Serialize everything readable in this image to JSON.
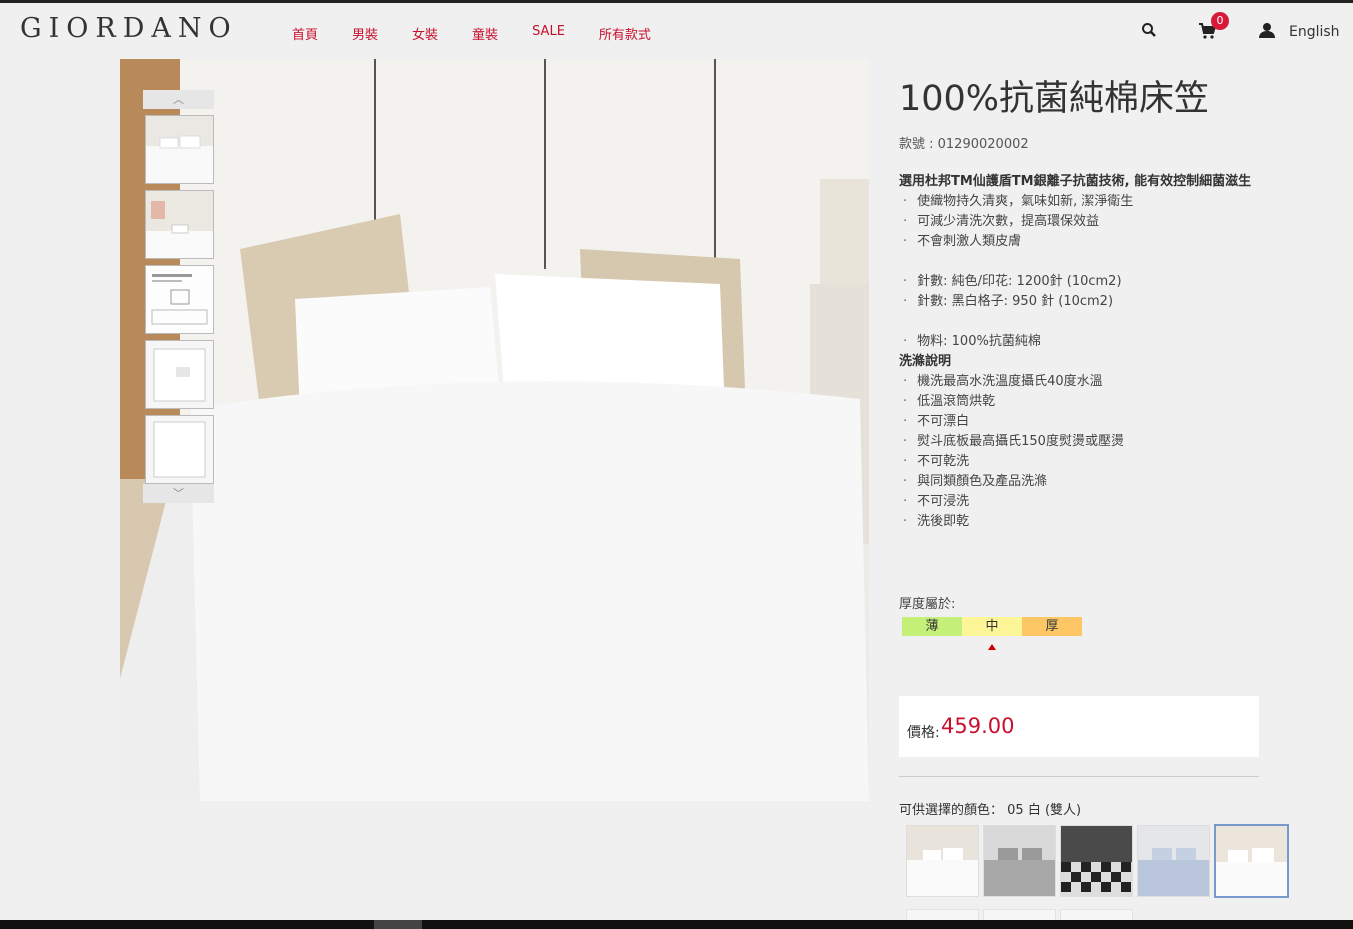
{
  "brand": "GIORDANO",
  "nav": [
    "首頁",
    "男裝",
    "女裝",
    "童裝",
    "SALE",
    "所有款式"
  ],
  "header": {
    "cart_count": "0",
    "language": "English"
  },
  "product": {
    "title": "100%抗菌純棉床笠",
    "sku": "款號 : 01290020002",
    "intro": "選用杜邦TM仙護盾TM銀離子抗菌技術, 能有效控制細菌滋生",
    "features": [
      "使織物持久清爽，氣味如新, 潔淨衛生",
      "可減少清洗次數，提高環保效益",
      "不會刺激人類皮膚"
    ],
    "thread_count": [
      "針數: 純色/印花: 1200針 (10cm2)",
      "針數: 黑白格子: 950 針 (10cm2)"
    ],
    "material": "物料: 100%抗菌純棉",
    "care_heading": "洗滌說明",
    "care": [
      "機洗最高水洗溫度攝氏40度水溫",
      "低溫滾筒烘乾",
      "不可漂白",
      "熨斗底板最高攝氏150度熨燙或壓燙",
      "不可乾洗",
      "與同類顏色及產品洗滌",
      "不可浸洗",
      "洗後即乾"
    ]
  },
  "thickness": {
    "label": "厚度屬於:",
    "levels": [
      "薄",
      "中",
      "厚"
    ],
    "selected": "中"
  },
  "price": {
    "label": "價格:",
    "value": "459.00"
  },
  "color": {
    "label": "可供選擇的顏色：",
    "selected": "05 白 (雙人)"
  },
  "icons": {
    "search": "search-icon",
    "cart": "cart-icon",
    "user": "user-icon",
    "up": "chevron-up-icon",
    "down": "chevron-down-icon"
  },
  "colors": {
    "accent": "#c8102e",
    "badge": "#d71a3a",
    "thin": "#c4f07a",
    "medium": "#fdf699",
    "thick": "#fdc765"
  }
}
